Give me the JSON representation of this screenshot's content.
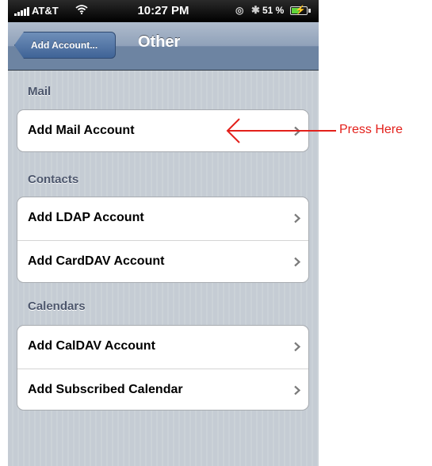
{
  "status_bar": {
    "carrier": "AT&T",
    "wifi_icon": "wifi-icon",
    "time": "10:27 PM",
    "lock_icon": "rotation-lock-icon",
    "bluetooth_icon": "bluetooth-icon",
    "battery_percent": "51 %",
    "battery_level": 0.51,
    "battery_charging": true
  },
  "nav_bar": {
    "back_label": "Add Account...",
    "title": "Other"
  },
  "sections": [
    {
      "header": "Mail",
      "rows": [
        {
          "label": "Add Mail Account"
        }
      ]
    },
    {
      "header": "Contacts",
      "rows": [
        {
          "label": "Add LDAP Account"
        },
        {
          "label": "Add CardDAV Account"
        }
      ]
    },
    {
      "header": "Calendars",
      "rows": [
        {
          "label": "Add CalDAV Account"
        },
        {
          "label": "Add Subscribed Calendar"
        }
      ]
    }
  ],
  "annotation": {
    "text": "Press Here",
    "color": "#e3201b"
  },
  "colors": {
    "nav_bar": "#6d84a2",
    "background": "#c5ccd4",
    "section_header": "#4c566c",
    "battery": "#5fd33a"
  }
}
